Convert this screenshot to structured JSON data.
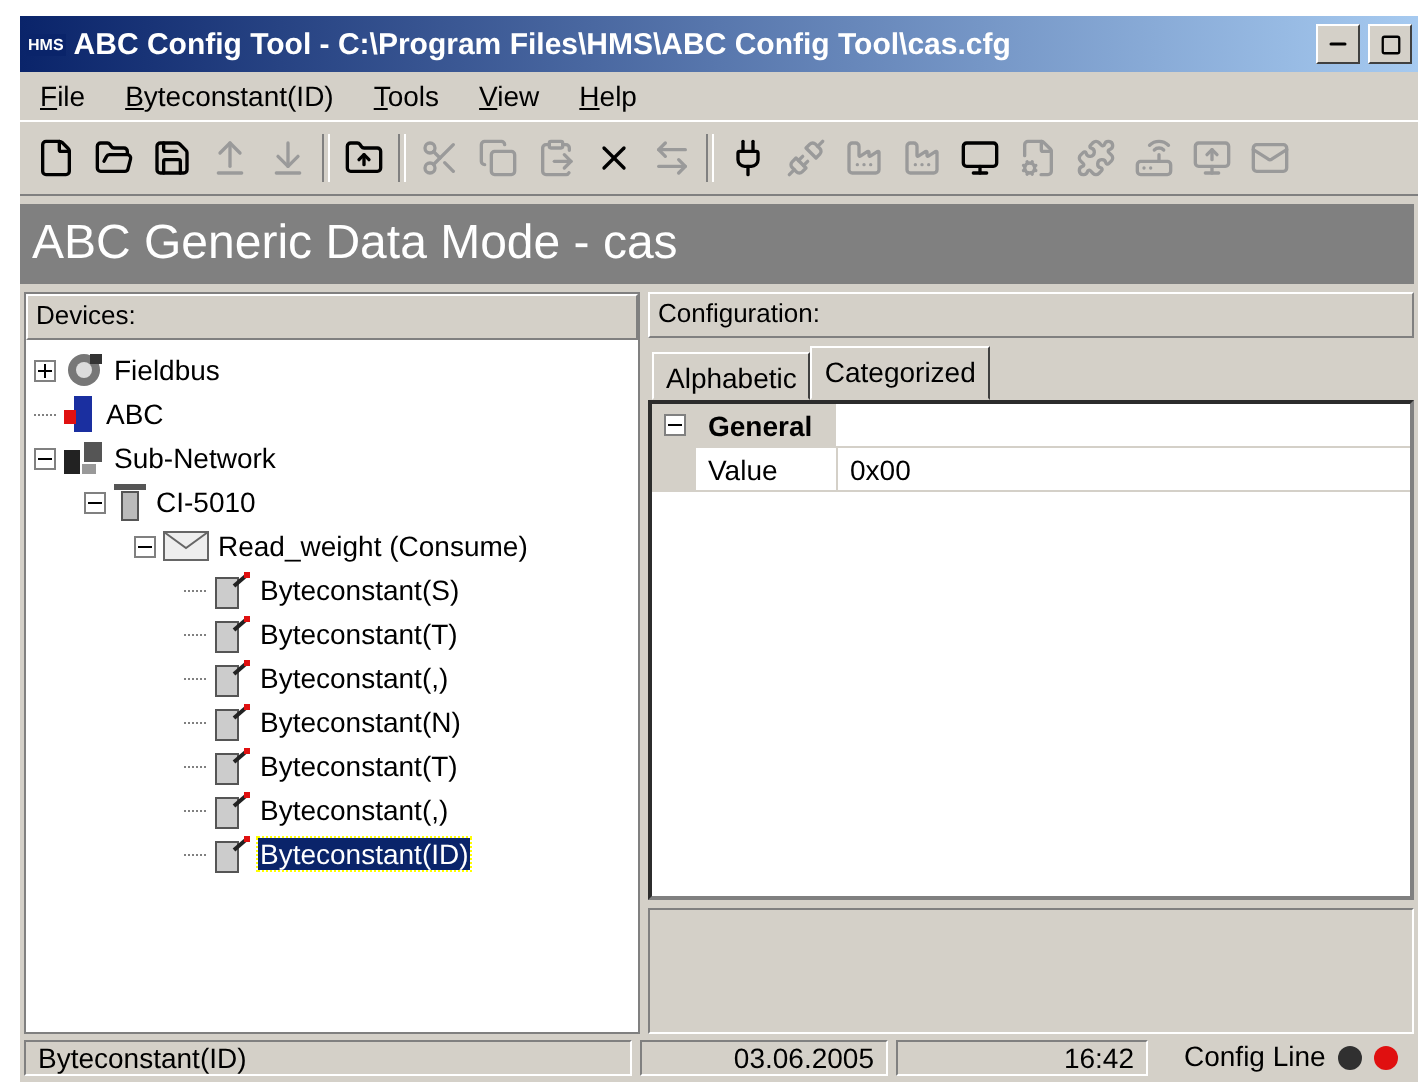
{
  "window": {
    "logo": "HMS",
    "title": "ABC Config Tool - C:\\Program Files\\HMS\\ABC Config Tool\\cas.cfg"
  },
  "menu": [
    {
      "label": "File"
    },
    {
      "label": "Byteconstant(ID)"
    },
    {
      "label": "Tools"
    },
    {
      "label": "View"
    },
    {
      "label": "Help"
    }
  ],
  "toolbar": [
    {
      "kind": "new",
      "disabled": false
    },
    {
      "kind": "open",
      "disabled": false
    },
    {
      "kind": "save",
      "disabled": false
    },
    {
      "kind": "upload",
      "disabled": true
    },
    {
      "kind": "download",
      "disabled": true
    },
    {
      "kind": "sep"
    },
    {
      "kind": "folderup",
      "disabled": false
    },
    {
      "kind": "sep"
    },
    {
      "kind": "cut",
      "disabled": true
    },
    {
      "kind": "copy",
      "disabled": true
    },
    {
      "kind": "paste",
      "disabled": true
    },
    {
      "kind": "delete",
      "disabled": false
    },
    {
      "kind": "transfer",
      "disabled": true
    },
    {
      "kind": "sep"
    },
    {
      "kind": "connect",
      "disabled": false
    },
    {
      "kind": "disconnect",
      "disabled": true
    },
    {
      "kind": "factory",
      "disabled": true
    },
    {
      "kind": "factory",
      "disabled": true
    },
    {
      "kind": "monitor",
      "disabled": false
    },
    {
      "kind": "properties",
      "disabled": true
    },
    {
      "kind": "puzzle",
      "disabled": true
    },
    {
      "kind": "router",
      "disabled": true
    },
    {
      "kind": "screen",
      "disabled": true
    },
    {
      "kind": "mail",
      "disabled": true
    }
  ],
  "banner": "ABC Generic Data Mode - cas",
  "devices": {
    "header": "Devices:",
    "tree": [
      {
        "label": "Fieldbus",
        "kind": "fieldbus",
        "expanded": false,
        "selected": false
      },
      {
        "label": "ABC",
        "kind": "abc",
        "selected": false
      },
      {
        "label": "Sub-Network",
        "kind": "subnet",
        "expanded": true,
        "selected": false,
        "children": [
          {
            "label": "CI-5010",
            "kind": "node",
            "expanded": true,
            "selected": false,
            "children": [
              {
                "label": "Read_weight (Consume)",
                "kind": "message",
                "expanded": true,
                "selected": false,
                "children": [
                  {
                    "label": "Byteconstant(S)",
                    "kind": "byte",
                    "selected": false
                  },
                  {
                    "label": "Byteconstant(T)",
                    "kind": "byte",
                    "selected": false
                  },
                  {
                    "label": "Byteconstant(,)",
                    "kind": "byte",
                    "selected": false
                  },
                  {
                    "label": "Byteconstant(N)",
                    "kind": "byte",
                    "selected": false
                  },
                  {
                    "label": "Byteconstant(T)",
                    "kind": "byte",
                    "selected": false
                  },
                  {
                    "label": "Byteconstant(,)",
                    "kind": "byte",
                    "selected": false
                  },
                  {
                    "label": "Byteconstant(ID)",
                    "kind": "byte",
                    "selected": true
                  }
                ]
              }
            ]
          }
        ]
      }
    ]
  },
  "configuration": {
    "header": "Configuration:",
    "tabs": [
      {
        "label": "Alphabetic",
        "selected": false
      },
      {
        "label": "Categorized",
        "selected": true
      }
    ],
    "categories": [
      {
        "name": "General",
        "expanded": true,
        "rows": [
          {
            "name": "Value",
            "value": "0x00"
          }
        ]
      }
    ]
  },
  "status_bar": {
    "selection": "Byteconstant(ID)",
    "date": "03.06.2005",
    "time": "16:42",
    "line": "Config Line",
    "leds": [
      {
        "color": "#303030"
      },
      {
        "color": "#e01010"
      }
    ]
  }
}
